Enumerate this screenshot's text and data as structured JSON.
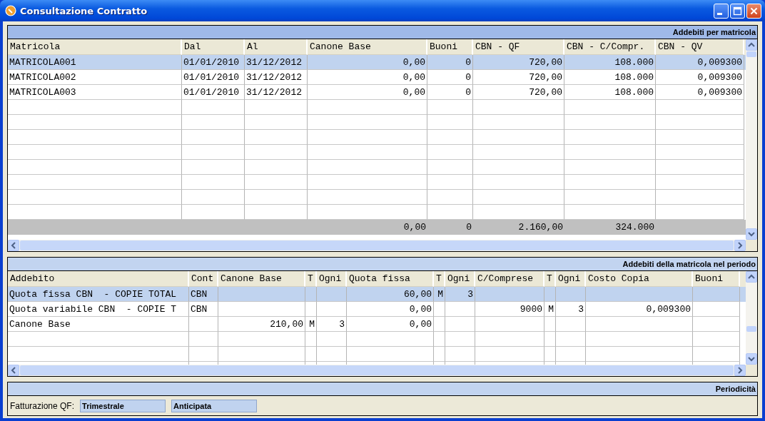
{
  "window": {
    "title": "Consultazione Contratto"
  },
  "panels": [
    {
      "kind": "table",
      "title": "Addebiti per matricola",
      "columns": [
        "Matricola",
        "Dal",
        "Al",
        "Canone Base",
        "Buoni",
        "CBN - QF",
        "CBN - C/Compr.",
        "CBN - QV"
      ],
      "rows": [
        {
          "selected": true,
          "cells": [
            "MATRICOLA001",
            "01/01/2010",
            "31/12/2012",
            "0,00",
            "0",
            "720,00",
            "108.000",
            "0,009300"
          ]
        },
        {
          "selected": false,
          "cells": [
            "MATRICOLA002",
            "01/01/2010",
            "31/12/2012",
            "0,00",
            "0",
            "720,00",
            "108.000",
            "0,009300"
          ]
        },
        {
          "selected": false,
          "cells": [
            "MATRICOLA003",
            "01/01/2010",
            "31/12/2012",
            "0,00",
            "0",
            "720,00",
            "108.000",
            "0,009300"
          ]
        }
      ],
      "totals": [
        "0,00",
        "0",
        "2.160,00",
        "324.000"
      ]
    },
    {
      "kind": "table",
      "title": "Addebiti della matricola nel periodo",
      "columns": [
        "Addebito",
        "Cont",
        "Canone Base",
        "T",
        "Ogni",
        "Quota fissa",
        "T",
        "Ogni",
        "C/Comprese",
        "T",
        "Ogni",
        "Costo Copia",
        "Buoni"
      ],
      "rows": [
        {
          "selected": true,
          "cells": [
            "Quota fissa CBN  - COPIE TOTAL",
            "CBN",
            null,
            null,
            null,
            "60,00",
            "M",
            "3",
            null,
            null,
            null,
            null,
            null
          ]
        },
        {
          "selected": false,
          "cells": [
            "Quota variabile CBN  - COPIE T",
            "CBN",
            null,
            null,
            null,
            "0,00",
            null,
            null,
            "9000",
            "M",
            "3",
            "0,009300",
            null
          ]
        },
        {
          "selected": false,
          "cells": [
            "Canone Base",
            null,
            "210,00",
            "M",
            "3",
            "0,00",
            null,
            null,
            null,
            null,
            null,
            null,
            null
          ]
        }
      ]
    },
    {
      "kind": "form",
      "title": "Periodicità",
      "label": "Fatturazione QF:",
      "fields": [
        "Trimestrale",
        "Anticipata"
      ]
    }
  ]
}
